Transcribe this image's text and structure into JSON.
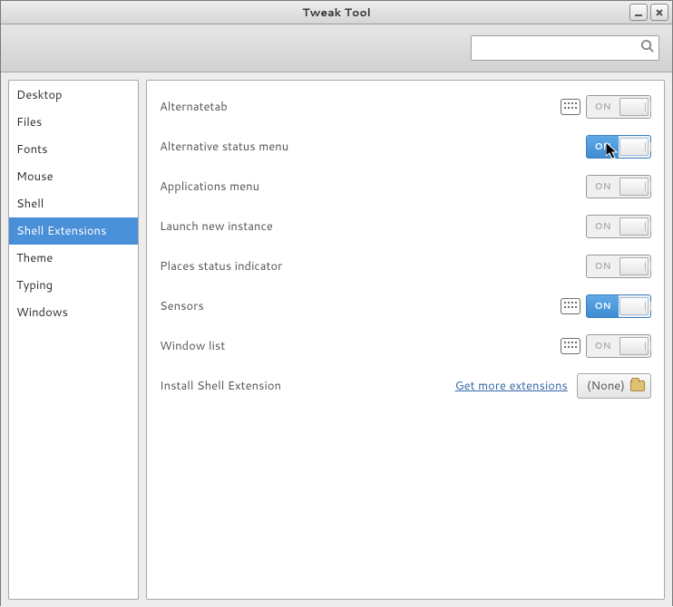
{
  "window": {
    "title": "Tweak Tool"
  },
  "search": {
    "placeholder": ""
  },
  "sidebar": {
    "items": [
      {
        "label": "Desktop",
        "selected": false
      },
      {
        "label": "Files",
        "selected": false
      },
      {
        "label": "Fonts",
        "selected": false
      },
      {
        "label": "Mouse",
        "selected": false
      },
      {
        "label": "Shell",
        "selected": false
      },
      {
        "label": "Shell Extensions",
        "selected": true
      },
      {
        "label": "Theme",
        "selected": false
      },
      {
        "label": "Typing",
        "selected": false
      },
      {
        "label": "Windows",
        "selected": false
      }
    ]
  },
  "extensions": [
    {
      "label": "Alternatetab",
      "has_prefs": true,
      "state": "off"
    },
    {
      "label": "Alternative status menu",
      "has_prefs": false,
      "state": "on"
    },
    {
      "label": "Applications menu",
      "has_prefs": false,
      "state": "off"
    },
    {
      "label": "Launch new instance",
      "has_prefs": false,
      "state": "off"
    },
    {
      "label": "Places status indicator",
      "has_prefs": false,
      "state": "off"
    },
    {
      "label": "Sensors",
      "has_prefs": true,
      "state": "on"
    },
    {
      "label": "Window list",
      "has_prefs": true,
      "state": "off"
    }
  ],
  "install": {
    "label": "Install Shell Extension",
    "link": "Get more extensions",
    "button": "(None)"
  },
  "switch_text": {
    "on": "ON"
  },
  "colors": {
    "selection": "#4a90d9",
    "link": "#3465a4",
    "switch_on": "#3f8cd1"
  }
}
